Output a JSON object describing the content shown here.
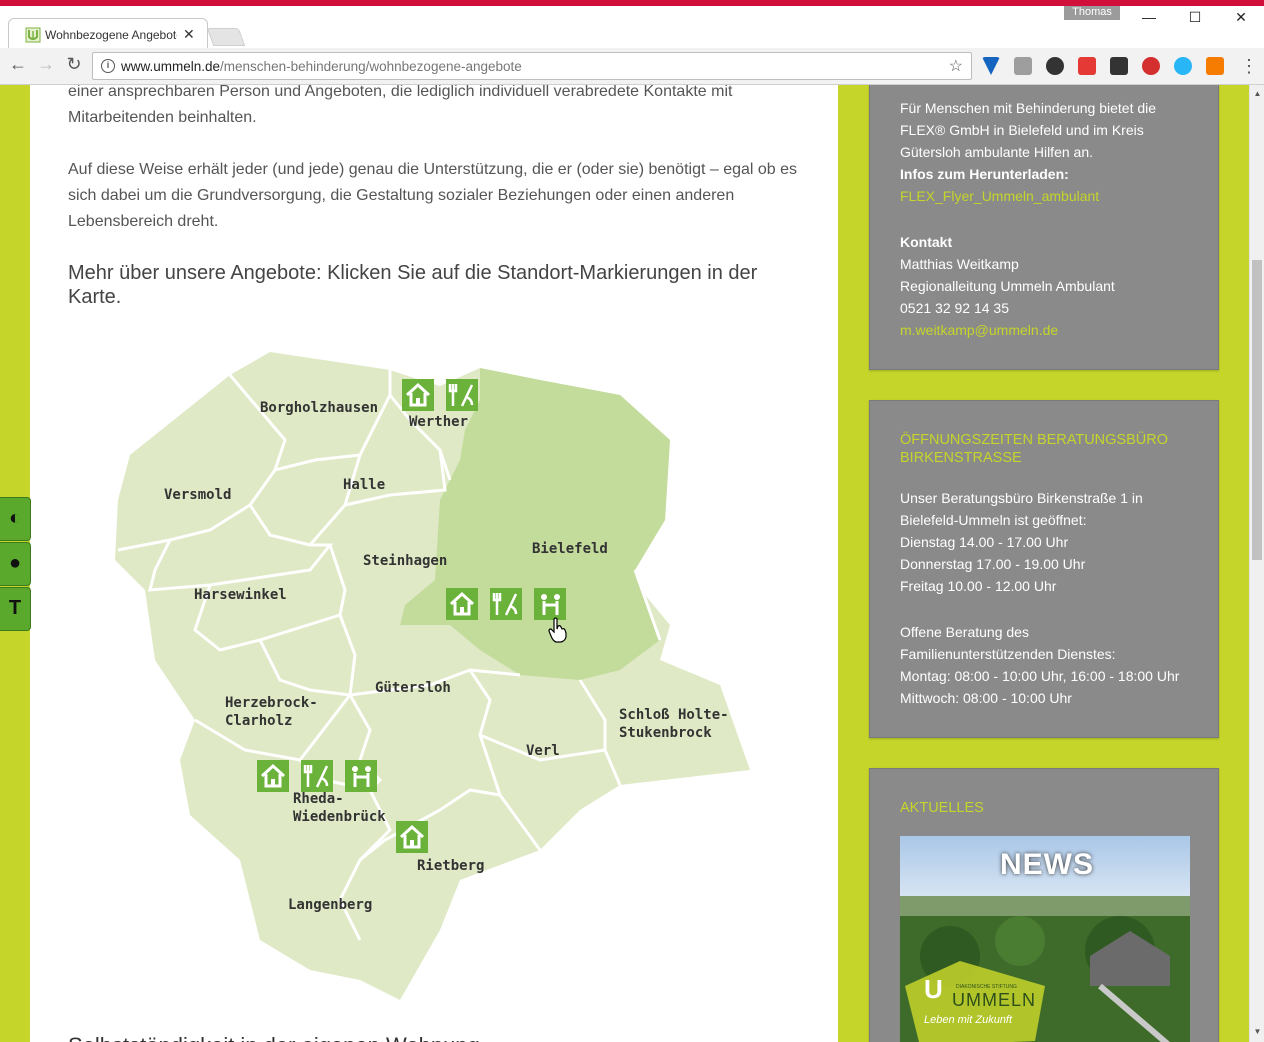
{
  "browser": {
    "tab_title": "Wohnbezogene Angebote",
    "profile_name": "Thomas",
    "url_host": "www.ummeln.de",
    "url_path": "/menschen-behinderung/wohnbezogene-angebote"
  },
  "content": {
    "para1": "einer ansprechbaren Person und Angeboten, die lediglich individuell verabredete Kontakte mit Mitarbeitenden beinhalten.",
    "para2": "Auf diese Weise erhält jeder (und jede) genau die Unterstützung, die er (oder sie) benötigt – egal ob es sich dabei um die Grundversorgung, die Gestaltung sozialer Beziehungen oder einen anderen Lebensbereich dreht.",
    "subheading": "Mehr über unsere Angebote: Klicken Sie auf die Standort-Markierungen in der Karte.",
    "cut_heading": "Selbstständigkeit in der eigenen Wohnung"
  },
  "map": {
    "regions": {
      "borgholzhausen": "Borgholzhausen",
      "werther": "Werther",
      "versmold": "Versmold",
      "halle": "Halle",
      "bielefeld": "Bielefeld",
      "steinhagen": "Steinhagen",
      "harsewinkel": "Harsewinkel",
      "guetersloh": "Gütersloh",
      "herzebrock_1": "Herzebrock-",
      "herzebrock_2": "Clarholz",
      "schloss_1": "Schloß Holte-",
      "schloss_2": "Stukenbrock",
      "verl": "Verl",
      "rheda_1": "Rheda-",
      "rheda_2": "Wiedenbrück",
      "rietberg": "Rietberg",
      "langenberg": "Langenberg"
    },
    "colors": {
      "land": "#dfe9c5",
      "bielefeld": "#c3dc9c",
      "marker": "#6ab23a",
      "border": "#ffffff"
    }
  },
  "sidebar": {
    "box1": {
      "line1": "Für Menschen mit Behinderung bietet die",
      "line2": "FLEX® GmbH in Bielefeld und im Kreis",
      "line3": "Gütersloh ambulante Hilfen an.",
      "download_label": "Infos zum Herunterladen:",
      "download_link": "FLEX_Flyer_Ummeln_ambulant",
      "contact_label": "Kontakt",
      "contact_name": "Matthias Weitkamp",
      "contact_role": "Regionalleitung Ummeln Ambulant",
      "contact_phone": "0521 32 92 14 35",
      "contact_email": "m.weitkamp@ummeln.de"
    },
    "box2": {
      "title_line1": "Öffnungszeiten Beratungsbüro",
      "title_line2": "Birkenstraße",
      "line1": "Unser Beratungsbüro Birkenstraße 1 in",
      "line2": "Bielefeld-Ummeln ist geöffnet:",
      "line3": "Dienstag 14.00 - 17.00 Uhr",
      "line4": "Donnerstag 17.00 - 19.00 Uhr",
      "line5": "Freitag 10.00 - 12.00 Uhr",
      "line6": "Offene Beratung des",
      "line7": "Familienunterstützenden Dienstes:",
      "line8": "Montag: 08:00 - 10:00 Uhr, 16:00 - 18:00 Uhr",
      "line9": "Mittwoch: 08:00 - 10:00 Uhr"
    },
    "box3": {
      "title": "Aktuelles",
      "news_label": "NEWS",
      "logo_small": "DIAKONISCHE STIFTUNG",
      "logo_name": "UMMELN",
      "logo_slogan": "Leben mit Zukunft"
    }
  }
}
